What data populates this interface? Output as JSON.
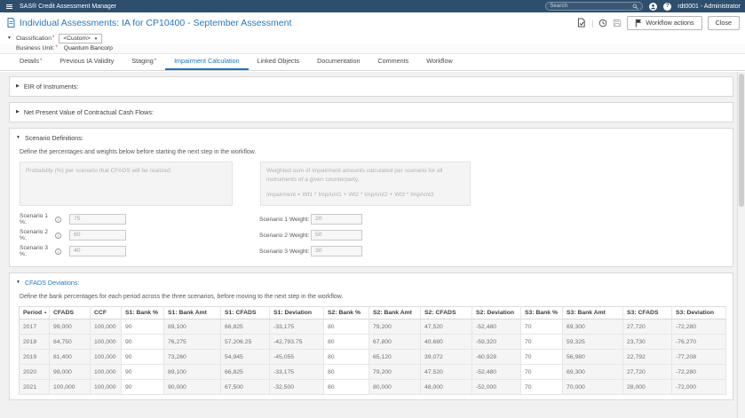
{
  "topbar": {
    "brand": "SAS® Credit Assessment Manager",
    "search_placeholder": "Search",
    "user": "rdt0001 - Administrator"
  },
  "header": {
    "title": "Individual Assessments: IA for CP10400 - September Assessment",
    "actions": {
      "workflow_label": "Workflow actions",
      "close_label": "Close"
    }
  },
  "classification": {
    "label": "Classification",
    "required": true,
    "value": "<Custom>",
    "business_unit_label": "Business Unit:",
    "business_unit_required": true,
    "business_unit_value": "Quantum Bancorp"
  },
  "tabs": [
    {
      "label": "Details",
      "required": true,
      "active": false
    },
    {
      "label": "Previous IA Validity",
      "required": false,
      "active": false
    },
    {
      "label": "Staging",
      "required": true,
      "active": false
    },
    {
      "label": "Impairment Calculation",
      "required": false,
      "active": true
    },
    {
      "label": "Linked Objects",
      "required": false,
      "active": false
    },
    {
      "label": "Documentation",
      "required": false,
      "active": false
    },
    {
      "label": "Comments",
      "required": false,
      "active": false
    },
    {
      "label": "Workflow",
      "required": false,
      "active": false
    }
  ],
  "sections": {
    "eir": {
      "title": "EIR of Instruments:",
      "collapsed": true
    },
    "npv": {
      "title": "Net Present Value of Contractual Cash Flows:",
      "collapsed": true
    },
    "scenario": {
      "title": "Scenario Definitions:",
      "instruction": "Define the percentages and weights below before starting the next step in the workflow.",
      "probability_hint": "Probability (%) per scenario that CFADS will be realized.",
      "weighted_hint": "Weighted sum of impairment amounts calculated per scenario for all instruments of a given counterparty.",
      "weighted_formula": "Impairment = Wt1 * ImpAmt1 + Wt2 * ImpAmt2 + Wt3 * ImpAmt3",
      "rows": [
        {
          "pct_label": "Scenario 1 %:",
          "pct_value": "75",
          "weight_label": "Scenario 1 Weight:",
          "weight_value": "20"
        },
        {
          "pct_label": "Scenario 2 %:",
          "pct_value": "60",
          "weight_label": "Scenario 2 Weight:",
          "weight_value": "50"
        },
        {
          "pct_label": "Scenario 3 %:",
          "pct_value": "40",
          "weight_label": "Scenario 3 Weight:",
          "weight_value": "30"
        }
      ]
    },
    "cfads": {
      "title": "CFADS Deviations:",
      "instruction": "Define the bank percentages for each period across the three scenarios, before moving to the next step in the workflow.",
      "table": {
        "columns": [
          "Period",
          "CFADS",
          "CCF",
          "S1: Bank %",
          "S1: Bank Amt",
          "S1: CFADS",
          "S1: Deviation",
          "S2: Bank %",
          "S2: Bank Amt",
          "S2: CFADS",
          "S2: Deviation",
          "S3: Bank %",
          "S3: Bank Amt",
          "S3: CFADS",
          "S3: Deviation"
        ],
        "sorted_column": "Period",
        "editable_columns": [
          3,
          7,
          11
        ],
        "rows": [
          [
            "2017",
            "99,000",
            "100,000",
            "90",
            "89,100",
            "66,825",
            "-33,175",
            "80",
            "79,200",
            "47,520",
            "-52,480",
            "70",
            "69,300",
            "27,720",
            "-72,280"
          ],
          [
            "2018",
            "84,750",
            "100,000",
            "90",
            "76,275",
            "57,206.25",
            "-42,793.75",
            "80",
            "67,800",
            "40,680",
            "-59,320",
            "70",
            "59,325",
            "23,730",
            "-76,270"
          ],
          [
            "2019",
            "81,400",
            "100,000",
            "90",
            "73,260",
            "54,945",
            "-45,055",
            "80",
            "65,120",
            "39,072",
            "-60,928",
            "70",
            "56,980",
            "22,792",
            "-77,208"
          ],
          [
            "2020",
            "99,000",
            "100,000",
            "90",
            "89,100",
            "66,825",
            "-33,175",
            "80",
            "79,200",
            "47,520",
            "-52,480",
            "70",
            "69,300",
            "27,720",
            "-72,280"
          ],
          [
            "2021",
            "100,000",
            "100,000",
            "90",
            "90,000",
            "67,500",
            "-32,500",
            "80",
            "80,000",
            "48,000",
            "-52,000",
            "70",
            "70,000",
            "28,000",
            "-72,000"
          ]
        ]
      }
    }
  },
  "colors": {
    "topbar_bg": "#2e4e6e",
    "title_blue": "#2878bd",
    "active_tab_blue": "#1b74bc",
    "required_red": "#c0392b",
    "readonly_cell_bg": "#f5f5f5"
  }
}
